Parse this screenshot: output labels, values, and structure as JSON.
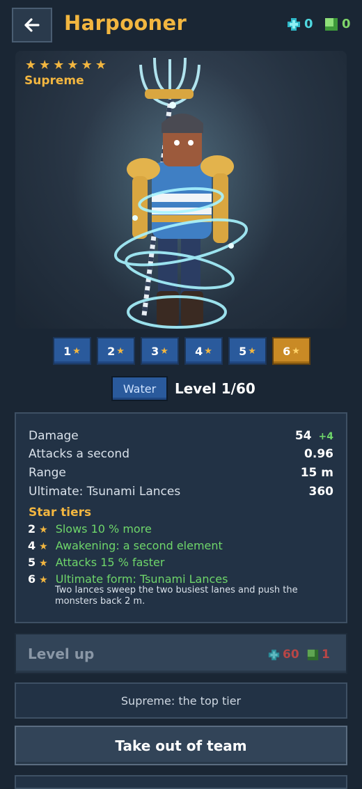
{
  "header": {
    "title": "Harpooner",
    "back_icon": "arrow-left-icon",
    "gems": "0",
    "blocks": "0"
  },
  "hero": {
    "stars": 6,
    "rarity": "Supreme"
  },
  "tier_buttons": [
    {
      "label": "1",
      "active": false
    },
    {
      "label": "2",
      "active": false
    },
    {
      "label": "3",
      "active": false
    },
    {
      "label": "4",
      "active": false
    },
    {
      "label": "5",
      "active": false
    },
    {
      "label": "6",
      "active": true
    }
  ],
  "element": "Water",
  "level": "Level 1/60",
  "stats": [
    {
      "name": "Damage",
      "value": "54",
      "bonus": "+4"
    },
    {
      "name": "Attacks a second",
      "value": "0.96"
    },
    {
      "name": "Range",
      "value": "15 m"
    },
    {
      "name": "Ultimate: Tsunami Lances",
      "value": "360"
    }
  ],
  "star_tiers": {
    "title": "Star tiers",
    "items": [
      {
        "tier": "2",
        "text": "Slows 10 % more"
      },
      {
        "tier": "4",
        "text": "Awakening: a second element"
      },
      {
        "tier": "5",
        "text": "Attacks 15 % faster"
      },
      {
        "tier": "6",
        "text": "Ultimate form: Tsunami Lances"
      }
    ],
    "ultimate_desc": "Two lances sweep the two busiest lanes and push the monsters back 2 m."
  },
  "level_up": {
    "label": "Level up",
    "cost_gems": "60",
    "cost_blocks": "1"
  },
  "info_text": "Supreme: the top tier",
  "team_button": "Take out of team",
  "colors": {
    "background": "#1a2634",
    "accent_gold": "#f2b640",
    "tier_blue": "#2a5a9c",
    "tier_active": "#c98a25",
    "bonus_green": "#6fd66a",
    "cost_red": "#b84646"
  }
}
